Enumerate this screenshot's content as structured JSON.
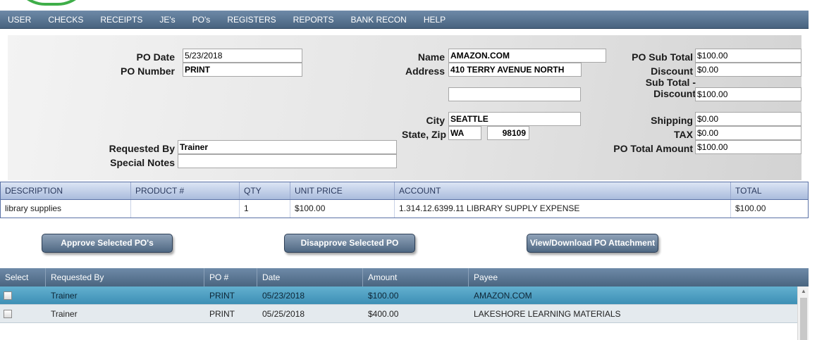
{
  "menu": [
    "USER",
    "CHECKS",
    "RECEIPTS",
    "JE's",
    "PO's",
    "REGISTERS",
    "REPORTS",
    "BANK RECON",
    "HELP"
  ],
  "form": {
    "po_date_label": "PO Date",
    "po_date": "5/23/2018",
    "po_number_label": "PO Number",
    "po_number": "PRINT",
    "requested_by_label": "Requested By",
    "requested_by": "Trainer",
    "special_notes_label": "Special Notes",
    "special_notes": "",
    "name_label": "Name",
    "name": "AMAZON.COM",
    "address_label": "Address",
    "address": "410 TERRY AVENUE NORTH",
    "address2": "",
    "city_label": "City",
    "city": "SEATTLE",
    "state_zip_label": "State, Zip",
    "state": "WA",
    "zip": "98109",
    "sub_total_label": "PO Sub Total",
    "sub_total": "$100.00",
    "discount_label": "Discount",
    "discount": "$0.00",
    "sub_minus_discount_label_1": "Sub Total -",
    "sub_minus_discount_label_2": "Discount",
    "sub_minus_discount": "$100.00",
    "shipping_label": "Shipping",
    "shipping": "$0.00",
    "tax_label": "TAX",
    "tax": "$0.00",
    "total_label": "PO Total Amount",
    "total": "$100.00"
  },
  "line_items": {
    "headers": [
      "DESCRIPTION",
      "PRODUCT #",
      "QTY",
      "UNIT PRICE",
      "ACCOUNT",
      "TOTAL"
    ],
    "rows": [
      [
        "library supplies",
        "",
        "1",
        "$100.00",
        "1.314.12.6399.11 LIBRARY SUPPLY EXPENSE",
        "$100.00"
      ]
    ]
  },
  "buttons": {
    "approve": "Approve Selected PO's",
    "disapprove": "Disapprove Selected PO",
    "attachment": "View/Download PO Attachment"
  },
  "po_list": {
    "headers": [
      "Select",
      "Requested By",
      "PO #",
      "Date",
      "Amount",
      "Payee"
    ],
    "rows": [
      [
        "Trainer",
        "PRINT",
        "05/23/2018",
        "$100.00",
        "AMAZON.COM"
      ],
      [
        "Trainer",
        "PRINT",
        "05/25/2018",
        "$400.00",
        "LAKESHORE LEARNING MATERIALS"
      ]
    ]
  },
  "colors": {
    "menu_bar": "#5a7592",
    "selected_row": "#4a9cc0",
    "logo_ring": "#3fae49"
  }
}
